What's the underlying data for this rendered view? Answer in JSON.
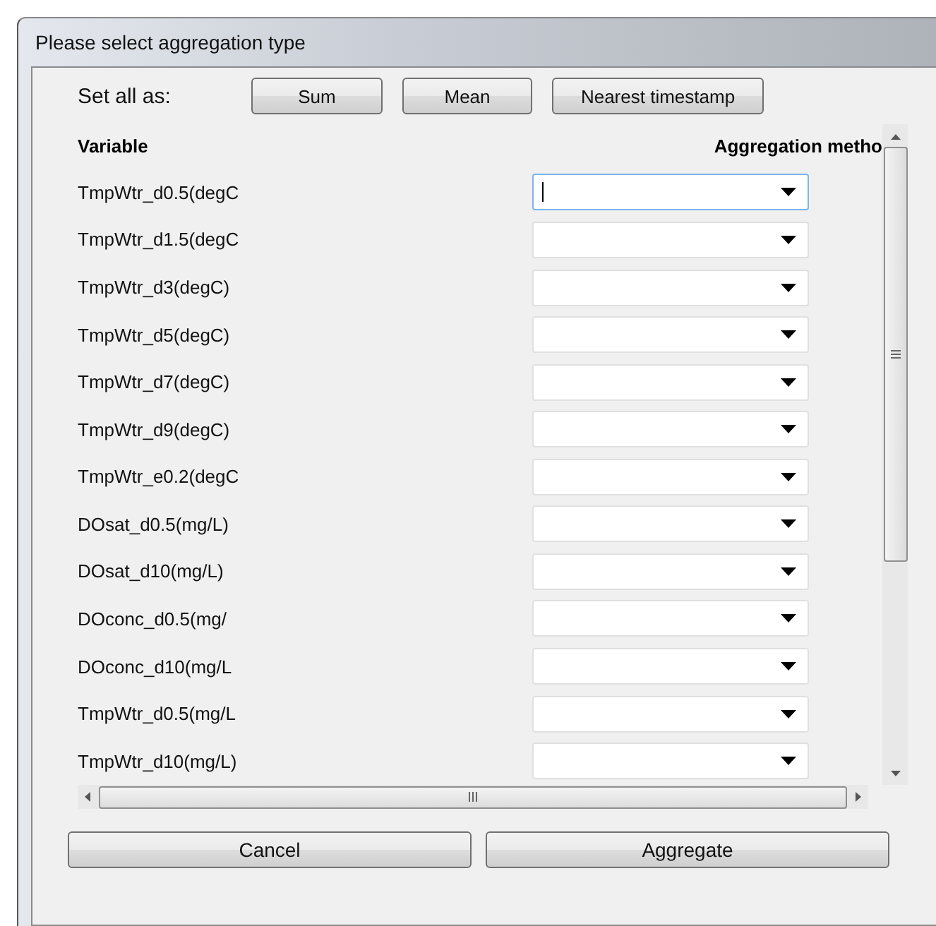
{
  "window": {
    "title": "Please select aggregation type"
  },
  "set_all": {
    "label": "Set all as:",
    "buttons": [
      "Sum",
      "Mean",
      "Nearest timestamp"
    ]
  },
  "columns": [
    "Variable",
    "Aggregation metho"
  ],
  "rows": [
    {
      "variable": "TmpWtr_d0.5(degC",
      "focused": true
    },
    {
      "variable": "TmpWtr_d1.5(degC",
      "focused": false
    },
    {
      "variable": "TmpWtr_d3(degC)",
      "focused": false
    },
    {
      "variable": "TmpWtr_d5(degC)",
      "focused": false
    },
    {
      "variable": "TmpWtr_d7(degC)",
      "focused": false
    },
    {
      "variable": "TmpWtr_d9(degC)",
      "focused": false
    },
    {
      "variable": "TmpWtr_e0.2(degC",
      "focused": false
    },
    {
      "variable": "DOsat_d0.5(mg/L)",
      "focused": false
    },
    {
      "variable": "DOsat_d10(mg/L)",
      "focused": false
    },
    {
      "variable": "DOconc_d0.5(mg/",
      "focused": false
    },
    {
      "variable": "DOconc_d10(mg/L",
      "focused": false
    },
    {
      "variable": "TmpWtr_d0.5(mg/L",
      "focused": false
    },
    {
      "variable": "TmpWtr_d10(mg/L)",
      "focused": false
    }
  ],
  "actions": [
    "Cancel",
    "Aggregate"
  ]
}
